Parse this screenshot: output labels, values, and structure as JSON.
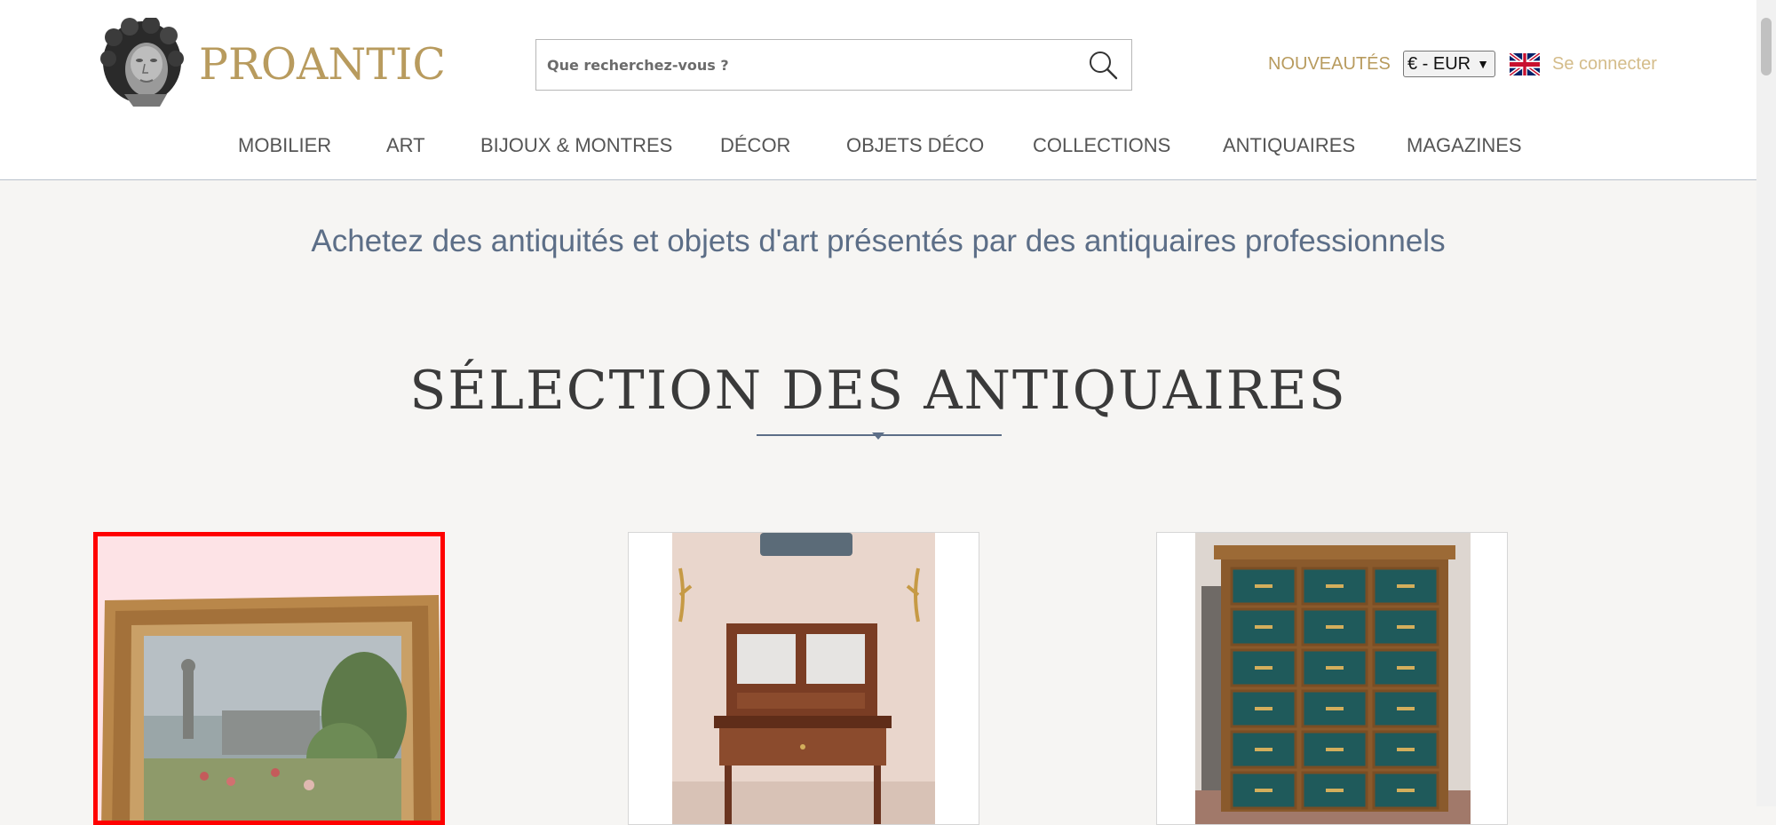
{
  "brand": {
    "name": "PROANTIC",
    "color": "#b89b5e"
  },
  "search": {
    "placeholder": "Que recherchez-vous ?",
    "icon": "search-icon"
  },
  "header": {
    "new_label": "NOUVEAUTÉS",
    "currency": "€ - EUR",
    "language_flag": "uk-flag-icon",
    "login_label": "Se connecter"
  },
  "nav": {
    "items": [
      {
        "label": "MOBILIER"
      },
      {
        "label": "ART"
      },
      {
        "label": "BIJOUX & MONTRES"
      },
      {
        "label": "DÉCOR"
      },
      {
        "label": "OBJETS DÉCO"
      },
      {
        "label": "COLLECTIONS"
      },
      {
        "label": "ANTIQUAIRES"
      },
      {
        "label": "MAGAZINES"
      }
    ]
  },
  "tagline": "Achetez des antiquités et objets d'art présentés par des antiquaires professionnels",
  "section": {
    "title": "SÉLECTION DES ANTIQUAIRES"
  },
  "products": [
    {
      "image": "framed-landscape-painting",
      "selected": true
    },
    {
      "image": "mahogany-writing-desk",
      "selected": false
    },
    {
      "image": "green-drawer-cabinet",
      "selected": false
    }
  ],
  "colors": {
    "accent": "#b89b5e",
    "tagline": "#5c6e87",
    "selection": "#ff0000"
  }
}
